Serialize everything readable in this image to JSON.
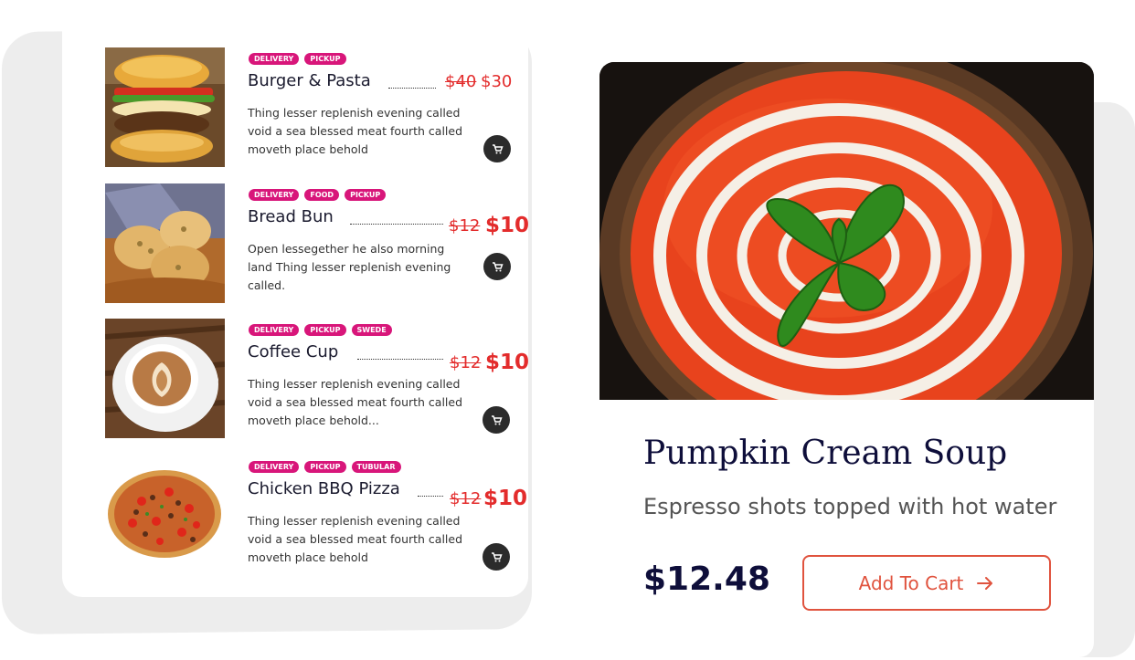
{
  "menu": {
    "items": [
      {
        "tags": [
          "DELIVERY",
          "PICKUP"
        ],
        "name": "Burger & Pasta",
        "old_price": "$40",
        "new_price": "$30",
        "description": "Thing lesser replenish evening called void a sea blessed meat fourth called moveth place behold",
        "cart_icon": "cart-icon",
        "image": "burger"
      },
      {
        "tags": [
          "DELIVERY",
          "FOOD",
          "PICKUP"
        ],
        "name": "Bread Bun",
        "old_price": "$12",
        "new_price": "$10",
        "description": "Open lessegether he also morning land Thing lesser replenish evening called.",
        "cart_icon": "cart-icon",
        "image": "bread"
      },
      {
        "tags": [
          "DELIVERY",
          "PICKUP",
          "SWEDE"
        ],
        "name": "Coffee Cup",
        "old_price": "$12",
        "new_price": "$10",
        "description": "Thing lesser replenish evening called void a sea blessed meat fourth called moveth place behold...",
        "cart_icon": "cart-icon",
        "image": "coffee"
      },
      {
        "tags": [
          "DELIVERY",
          "PICKUP",
          "TUBULAR"
        ],
        "name": "Chicken BBQ Pizza",
        "old_price": "$12",
        "new_price": "$10",
        "description": "Thing lesser replenish evening called void a sea blessed meat fourth called moveth place behold",
        "cart_icon": "cart-icon",
        "image": "pizza"
      }
    ]
  },
  "product": {
    "title": "Pumpkin Cream Soup",
    "subtitle": "Espresso shots topped with hot water",
    "price": "$12.48",
    "add_to_cart_label": "Add To Cart",
    "arrow_icon": "arrow-right-icon",
    "image": "tomato-soup-with-basil"
  },
  "colors": {
    "tag": "#d8167a",
    "price": "#e32c2c",
    "accent": "#e0533e",
    "heading": "#0e0e3a"
  }
}
